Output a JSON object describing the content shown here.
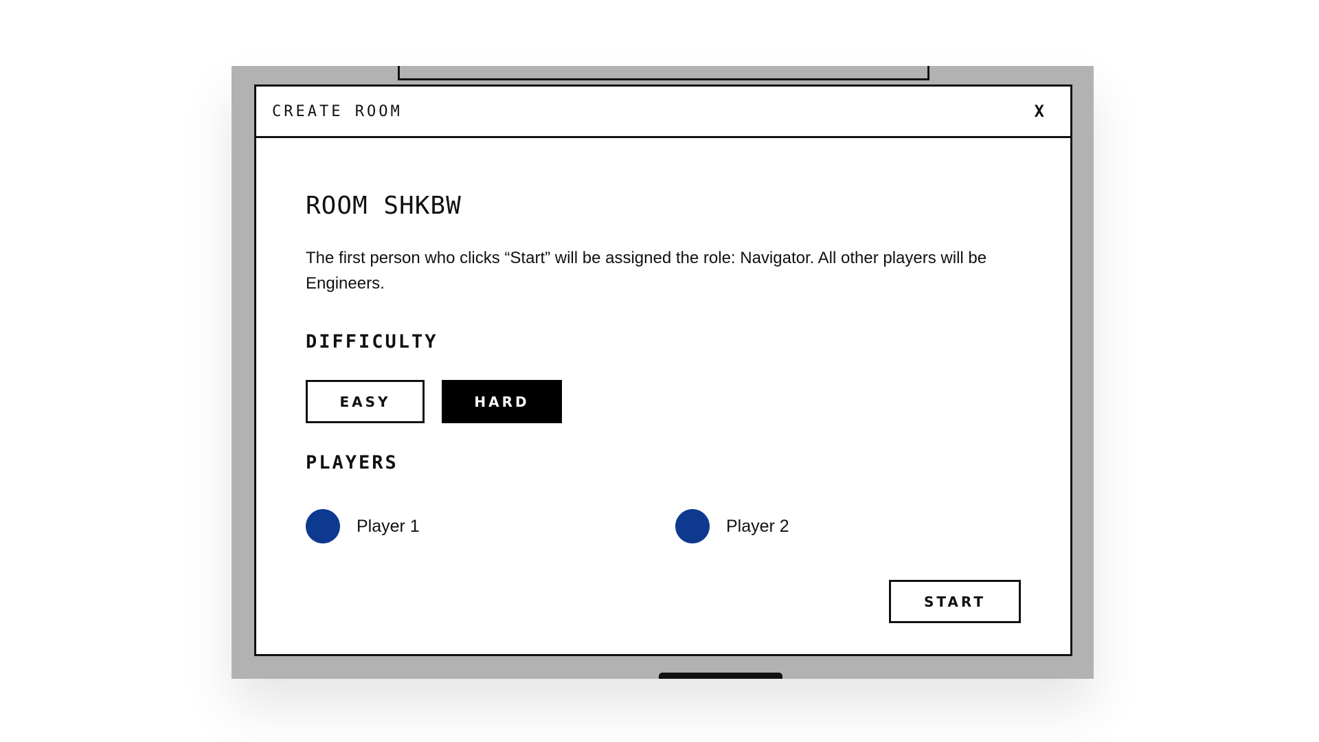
{
  "modal": {
    "title": "CREATE ROOM",
    "close_label": "X"
  },
  "room": {
    "title": "ROOM SHKBW",
    "description": "The first person who clicks “Start” will be assigned the role: Navigator. All other players will be Engineers."
  },
  "difficulty": {
    "label": "DIFFICULTY",
    "options": [
      {
        "label": "EASY",
        "selected": false
      },
      {
        "label": "HARD",
        "selected": true
      }
    ]
  },
  "players": {
    "label": "PLAYERS",
    "list": [
      {
        "name": "Player 1",
        "color": "#0d3a8f"
      },
      {
        "name": "Player 2",
        "color": "#0d3a8f"
      }
    ]
  },
  "actions": {
    "start_label": "START"
  },
  "colors": {
    "backdrop": "#b2b2b2",
    "border": "#111111",
    "selected_bg": "#000000",
    "avatar": "#0d3a8f"
  }
}
